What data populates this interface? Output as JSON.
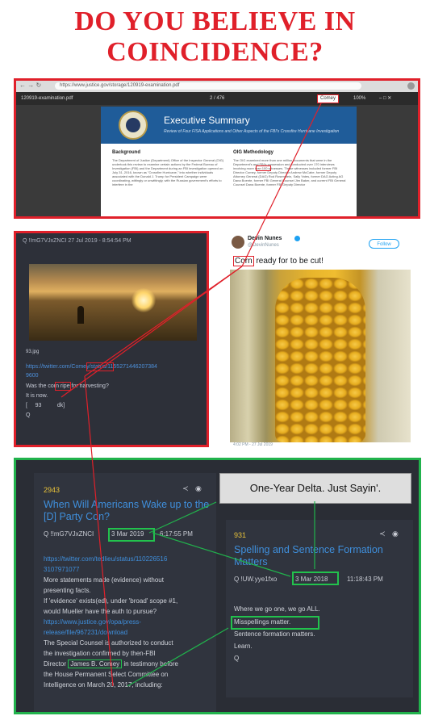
{
  "headline": {
    "line1": "DO YOU BELIEVE IN",
    "line2": "COINCIDENCE?"
  },
  "browser": {
    "url": "https://www.justice.gov/storage/120919-examination.pdf",
    "filename": "120919-examination.pdf",
    "page": "2 / 476",
    "search_term": "Comey",
    "zoom": "100%",
    "doc_title": "Executive Summary",
    "doc_subtitle": "Review of Four FISA Applications and Other Aspects of the FBI's Crossfire Hurricane Investigation",
    "col1_heading": "Background",
    "col1_text": "The Department of Justice (Department) Office of the Inspector General (OIG) undertook this review to examine certain actions by the Federal Bureau of Investigation (FBI) and the Department during an FBI investigation opened on July 31, 2016, known as \"Crossfire Hurricane,\" into whether individuals associated with the Donald J. Trump for President Campaign were coordinating, wittingly or unwittingly, with the Russian government's efforts to interfere in the",
    "col2_heading": "OIG Methodology",
    "col2_text": "The OIG examined more than one million documents that were in the Department's and FBI's possession and conducted over 170 interviews involving more than 100 witnesses. These witnesses included former FBI Director Comey, former Deputy Director Andrew McCabe, former Deputy Attorney General (DAG) Rod Rosenstein, Sally Yates, former DAG Acting AG Dana Boente, former FBI General Counsel Jim Baker, and current FBI General Counsel Dana Boente, former FBI Deputy Director"
  },
  "qpost": {
    "header": "Q !!mG7VJxZNCI 27 Jul 2019 - 8:54:54 PM",
    "image_caption": "93.jpg",
    "link": "https://twitter.com/Comey/status/1155271446207384",
    "link2": "9600",
    "line1": "Was the corn ripe for harvesting?",
    "line2": "It is now.",
    "line3": "[     93          dk]",
    "sign": "Q"
  },
  "tweet": {
    "name": "Devin Nunes",
    "handle": "@DevinNunes",
    "follow": "Follow",
    "text_word": "Corn",
    "text_rest": " ready for to be cut!",
    "date": "4:02 PM - 27 Jul 2019"
  },
  "post_left": {
    "number": "2943",
    "title": "When Will Americans Wake up to the [D] Party Con?",
    "author": "Q !!mG7VJxZNCI",
    "date": "3 Mar 2019",
    "time": "6:17:55 PM",
    "link1": "https://twitter.com/tedlieu/status/110226516",
    "link1b": "3107971077",
    "p1": "More statements made (evidence) without",
    "p2": "presenting facts.",
    "p3": "If 'evidence' exists(ed), under 'broad' scope #1,",
    "p4": "would Mueller have the auth to pursue?",
    "link2": "https://www.justice.gov/opa/press-",
    "link2b": "release/file/967231/download",
    "p5": "The Special Counsel is authorized to conduct",
    "p6": "the investigation confirmed by then-FBI",
    "p7_a": "Director",
    "p7_name": "James B. Comey",
    "p7_b": "in testimony before",
    "p8": "the House Permanent Select Committee on",
    "p9": "Intelligence on March 20, 2017, including:"
  },
  "delta_label": "One-Year Delta. Just Sayin'.",
  "post_right": {
    "number": "931",
    "title": "Spelling and Sentence Formation Matters",
    "author": "Q !UW.yye1fxo",
    "date": "3 Mar 2018",
    "time": "11:18:43 PM",
    "p1": "Where we go one, we go ALL.",
    "p2": "Misspellings matter.",
    "p3": "Sentence formation matters.",
    "p4": "Learn.",
    "p5": "Q"
  },
  "colors": {
    "headline": "#e0202a",
    "red_box": "#e0202a",
    "green_box": "#21b24c",
    "link_blue": "#3f8fdc",
    "post_number": "#e8c23a"
  }
}
